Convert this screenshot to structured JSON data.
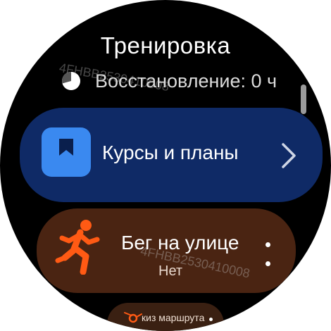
{
  "screen": {
    "title": "Тренировка",
    "recovery_text": "Восстановление: 0 ч"
  },
  "cards": {
    "courses": {
      "label": "Курсы и планы",
      "icon": "bookmark-icon",
      "icon_color": "#3a89f0",
      "background": "#0f2a66"
    },
    "outdoor_run": {
      "label": "Бег на улице",
      "sublabel": "Нет",
      "icon": "runner-icon",
      "icon_color": "#ff5a14",
      "background": "#4a2412"
    },
    "route": {
      "label": "киз маршрута",
      "icon": "route-icon"
    }
  },
  "watermark": "4FHBB2530410008"
}
